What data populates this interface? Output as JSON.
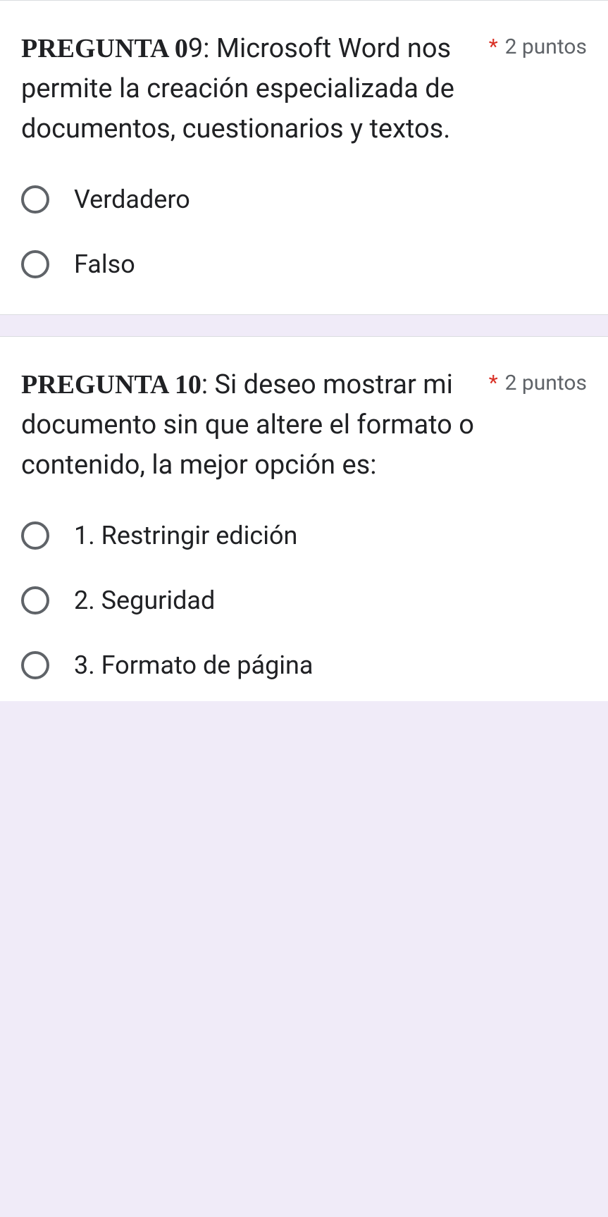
{
  "questions": [
    {
      "prefix": "PREGUNTA 0",
      "number": "9",
      "text": ": Microsoft Word nos permite la creación especializada de documentos, cuestionarios y textos.",
      "required_star": "*",
      "points": "2 puntos",
      "options": [
        {
          "label": "Verdadero"
        },
        {
          "label": "Falso"
        }
      ]
    },
    {
      "prefix": "PREGUNTA 1",
      "number": "0",
      "text": ": Si deseo mostrar mi documento sin que altere el formato o contenido, la mejor opción es:",
      "required_star": "*",
      "points": "2 puntos",
      "options": [
        {
          "label": "1. Restringir edición"
        },
        {
          "label": "2. Seguridad"
        },
        {
          "label": "3. Formato de página"
        }
      ]
    }
  ]
}
